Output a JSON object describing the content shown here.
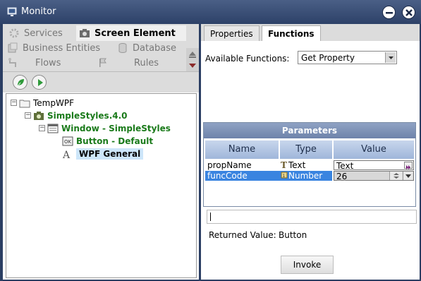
{
  "window": {
    "title": "Monitor"
  },
  "accordion": {
    "items": [
      {
        "label": "Services",
        "icon": "services-icon"
      },
      {
        "label": "Screen Element",
        "icon": "camera-icon"
      },
      {
        "label": "Business Entities",
        "icon": "entities-icon"
      },
      {
        "label": "Database",
        "icon": "database-icon"
      },
      {
        "label": "Flows",
        "icon": "flows-icon"
      },
      {
        "label": "Rules",
        "icon": "rules-flag-icon"
      }
    ],
    "active": "Screen Element"
  },
  "tree": {
    "nodes": [
      {
        "label": "TempWPF"
      },
      {
        "label": "SimpleStyles.4.0"
      },
      {
        "label": "Window - SimpleStyles"
      },
      {
        "label": "Button - Default"
      },
      {
        "label": "WPF General"
      }
    ]
  },
  "tabs": [
    {
      "label": "Properties"
    },
    {
      "label": "Functions"
    }
  ],
  "functions": {
    "available_label": "Available Functions:",
    "selected": "Get Property"
  },
  "parameters": {
    "title": "Parameters",
    "columns": [
      "Name",
      "Type",
      "Value"
    ],
    "rows": [
      {
        "name": "propName",
        "type": "Text",
        "value": "Text"
      },
      {
        "name": "funcCode",
        "type": "Number",
        "value": "26"
      }
    ]
  },
  "returned": {
    "label": "Returned Value:",
    "value": "Button"
  },
  "invoke_label": "Invoke",
  "colors": {
    "titlebar": "#2d4168",
    "selection": "#3a84e0",
    "tree_green": "#1a7a1a"
  }
}
